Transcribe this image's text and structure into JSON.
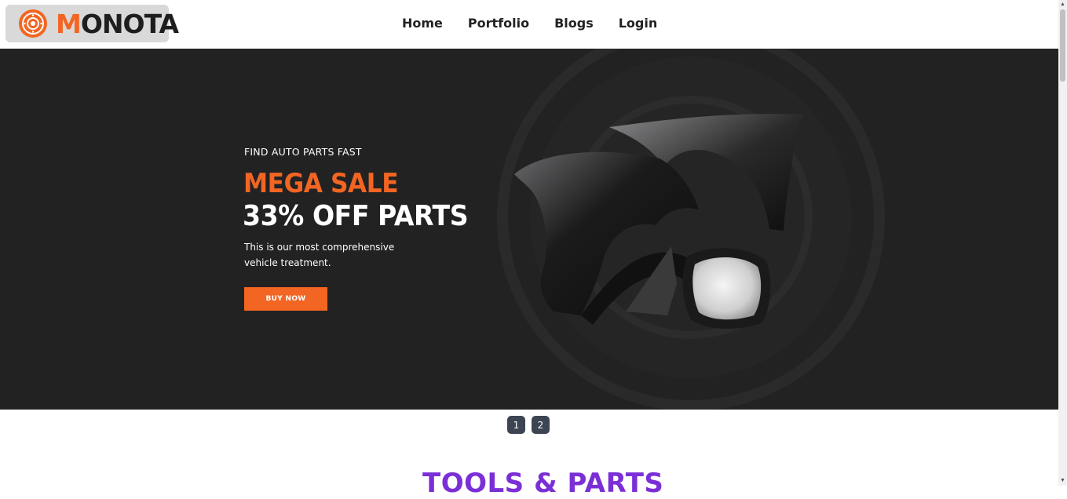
{
  "header": {
    "logo": {
      "first_letter": "M",
      "rest": "ONOTA",
      "icon": "brake-disc-icon"
    },
    "nav": [
      {
        "label": "Home"
      },
      {
        "label": "Portfolio"
      },
      {
        "label": "Blogs"
      },
      {
        "label": "Login"
      }
    ]
  },
  "hero": {
    "kicker": "FIND AUTO PARTS FAST",
    "title_line1": "MEGA SALE",
    "title_line2": "33% OFF PARTS",
    "description": "This is our most comprehensive vehicle treatment.",
    "cta_label": "BUY NOW",
    "image": "fender-and-mirror-parts-image"
  },
  "pager": {
    "pages": [
      "1",
      "2"
    ]
  },
  "section": {
    "title": "TOOLS & PARTS"
  },
  "colors": {
    "accent": "#f26522",
    "hero_bg": "#222223",
    "section_title": "#7b2fd6",
    "pager_bg": "#3d4452"
  }
}
